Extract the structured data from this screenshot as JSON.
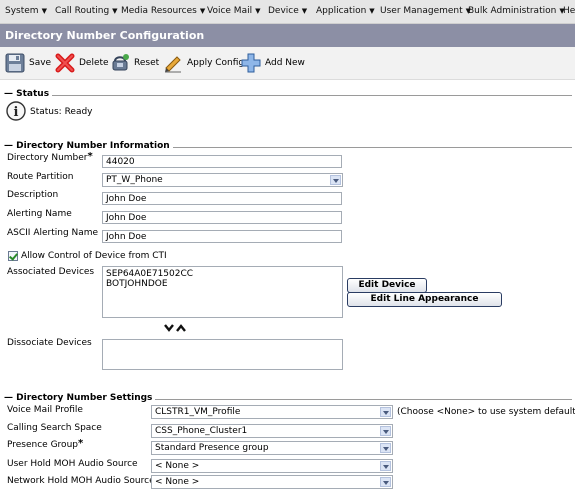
{
  "menu": {
    "items": [
      {
        "label": "System"
      },
      {
        "label": "Call Routing"
      },
      {
        "label": "Media Resources"
      },
      {
        "label": "Voice Mail"
      },
      {
        "label": "Device"
      },
      {
        "label": "Application"
      },
      {
        "label": "User Management"
      },
      {
        "label": "Bulk Administration"
      },
      {
        "label": "Help"
      }
    ]
  },
  "page": {
    "title": "Directory Number Configuration"
  },
  "toolbar": {
    "save_label": "Save",
    "delete_label": "Delete",
    "reset_label": "Reset",
    "apply_config_label": "Apply Config",
    "add_new_label": "Add New"
  },
  "status": {
    "heading": "Status",
    "text": "Status: Ready"
  },
  "dn_info": {
    "heading": "Directory Number Information",
    "directory_number_label": "Directory Number",
    "directory_number_value": "44020",
    "route_partition_label": "Route Partition",
    "route_partition_value": "PT_W_Phone",
    "description_label": "Description",
    "description_value": "John Doe",
    "alerting_name_label": "Alerting Name",
    "alerting_name_value": "John Doe",
    "ascii_alerting_name_label": "ASCII Alerting Name",
    "ascii_alerting_name_value": "John Doe",
    "allow_cti_label": "Allow Control of Device from CTI",
    "associated_devices_label": "Associated Devices",
    "associated_devices": [
      "SEP64A0E71502CC",
      "BOTJOHNDOE"
    ],
    "edit_device_label": "Edit Device",
    "edit_line_appearance_label": "Edit Line Appearance",
    "dissociate_devices_label": "Dissociate Devices"
  },
  "dn_settings": {
    "heading": "Directory Number Settings",
    "voice_mail_profile_label": "Voice Mail Profile",
    "voice_mail_profile_value": "CLSTR1_VM_Profile",
    "voice_mail_profile_hint": "(Choose <None> to use system default)",
    "css_label": "Calling Search Space",
    "css_value": "CSS_Phone_Cluster1",
    "presence_group_label": "Presence Group",
    "presence_group_value": "Standard Presence group",
    "user_hold_label": "User Hold MOH Audio Source",
    "user_hold_value": "< None >",
    "network_hold_label": "Network Hold MOH Audio Source",
    "network_hold_value": "< None >"
  }
}
